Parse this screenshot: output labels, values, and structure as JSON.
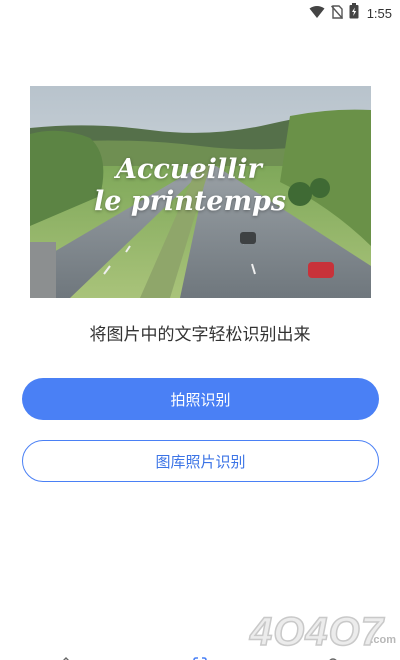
{
  "status_bar": {
    "time": "1:55",
    "icons": [
      "wifi-icon",
      "no-sim-icon",
      "battery-charging-icon"
    ]
  },
  "hero": {
    "caption_line1": "Accueillir",
    "caption_line2": "le printemps"
  },
  "subtitle": "将图片中的文字轻松识别出来",
  "buttons": {
    "camera_label": "拍照识别",
    "gallery_label": "图库照片识别"
  },
  "watermark": {
    "text": "4O4O7",
    "suffix": ".com"
  },
  "bottom_nav": {
    "icons": [
      "home-icon",
      "scan-icon",
      "profile-icon"
    ]
  },
  "colors": {
    "accent": "#4a80f5",
    "outline_text": "#3c74e6"
  }
}
